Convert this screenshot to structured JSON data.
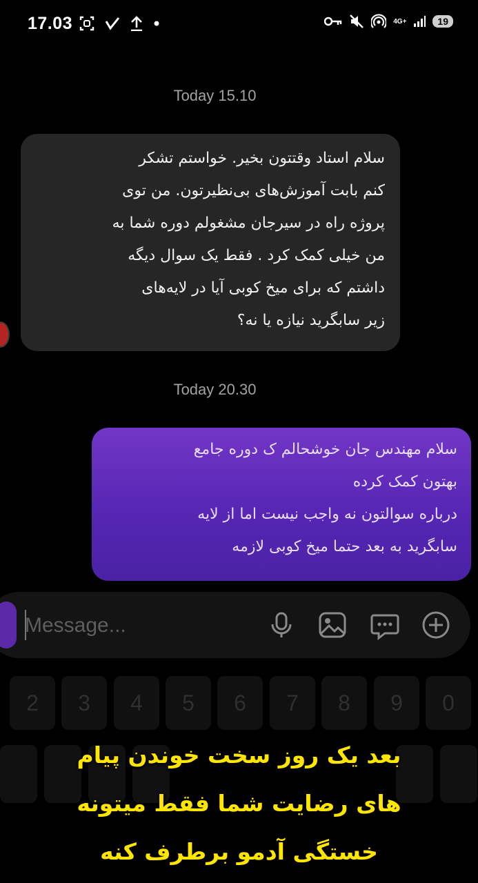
{
  "status_bar": {
    "time": "17.03",
    "network": "4G+",
    "battery": "19",
    "icons_left": [
      "screenshot-icon",
      "check-icon",
      "upload-icon",
      "dot-icon"
    ],
    "icons_right": [
      "key-icon",
      "mute-icon",
      "hotspot-icon",
      "signal-icon"
    ]
  },
  "chat": {
    "messages": [
      {
        "timestamp": "Today 15.10",
        "direction": "incoming",
        "text": "سلام استاد وقتتون بخیر. خواستم تشکر\nکنم بابت آموزش‌های بی‌نظیرتون. من توی\nپروژه راه در سیرجان مشغولم دوره شما به\nمن خیلی کمک کرد . فقط یک سوال دیگه\nداشتم که برای میخ کوبی آیا در لایه‌های\nزیر سابگرید نیازه یا نه؟"
      },
      {
        "timestamp": "Today 20.30",
        "direction": "outgoing",
        "text": "سلام مهندس جان خوشحالم ک دوره جامع\nبهتون کمک کرده\nدرباره سوالتون نه واجب نیست اما از لایه\nسابگرید به بعد حتما میخ کوبی لازمه"
      }
    ]
  },
  "composer": {
    "placeholder": "Message...",
    "icons": [
      "microphone-icon",
      "gallery-icon",
      "sticker-icon",
      "add-icon"
    ]
  },
  "keyboard": {
    "number_row": [
      "2",
      "3",
      "4",
      "5",
      "6",
      "7",
      "8",
      "9",
      "0"
    ]
  },
  "caption": {
    "lines": [
      "بعد یک روز سخت خوندن پیام",
      "های رضایت شما فقط میتونه",
      "خستگی آدمو برطرف کنه"
    ]
  },
  "colors": {
    "caption": "#ffe600",
    "incoming_bubble": "#262626",
    "outgoing_bubble_top": "#7236c6",
    "outgoing_bubble_bottom": "#4a22a4"
  }
}
